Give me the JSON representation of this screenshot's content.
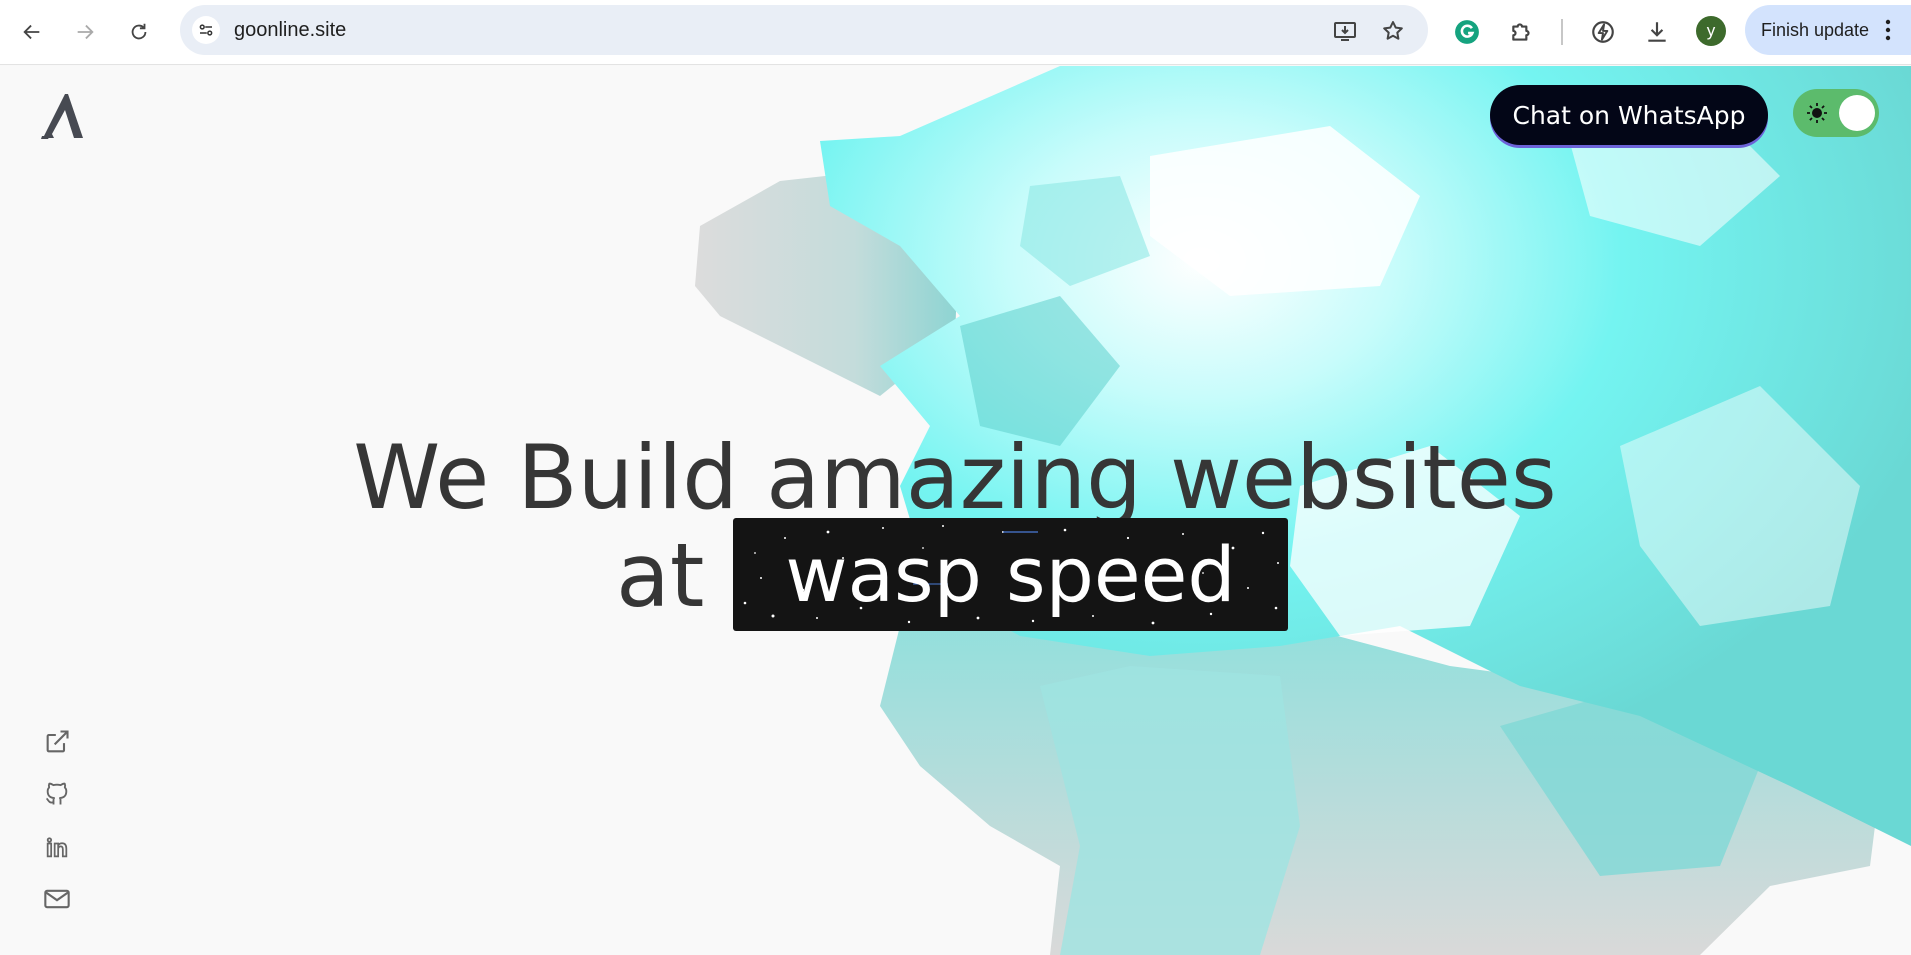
{
  "browser": {
    "url": "goonline.site",
    "finish_update_label": "Finish update",
    "profile_initial": "y",
    "icons": {
      "back": "back-arrow-icon",
      "forward": "forward-arrow-icon",
      "reload": "reload-icon",
      "site_info": "tune-icon",
      "install": "install-app-icon",
      "bookmark": "star-icon",
      "grammarly": "grammarly-icon",
      "extensions": "puzzle-icon",
      "performance": "performance-icon",
      "downloads": "download-icon",
      "menu": "vertical-dots-icon"
    }
  },
  "page": {
    "logo": "A",
    "whatsapp_label": "Chat on WhatsApp",
    "theme_toggle_on": true,
    "headline": {
      "line1": "We Build amazing websites",
      "line2_prefix": "at",
      "highlight": "wasp speed"
    },
    "social_icons": [
      "external-link-icon",
      "github-icon",
      "linkedin-icon",
      "mail-icon"
    ],
    "colors": {
      "background": "#f9f9f9",
      "headline_text": "#363636",
      "whatsapp_button": "#030617",
      "toggle_on": "#5cbb6c",
      "blob_cyan": "#7af5f0"
    }
  }
}
